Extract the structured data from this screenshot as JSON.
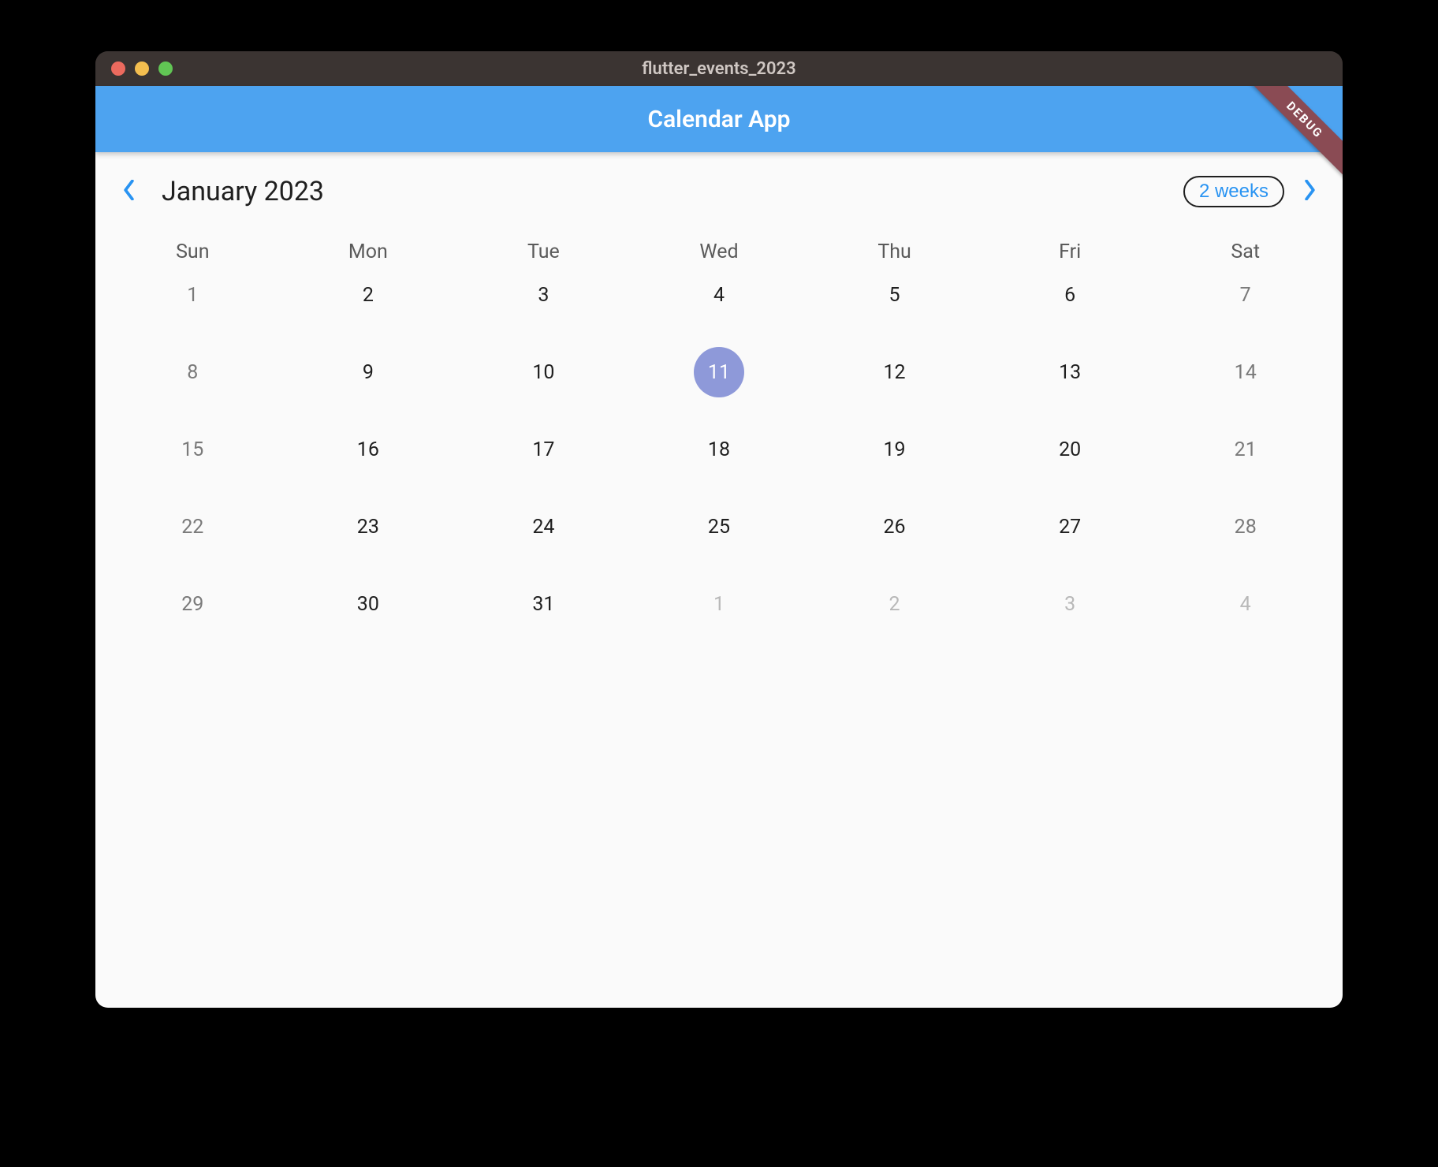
{
  "window": {
    "title": "flutter_events_2023"
  },
  "appbar": {
    "title": "Calendar App"
  },
  "debug_banner": "DEBUG",
  "calendar": {
    "month_label": "January 2023",
    "format_button": "2 weeks",
    "days_of_week": [
      "Sun",
      "Mon",
      "Tue",
      "Wed",
      "Thu",
      "Fri",
      "Sat"
    ],
    "weeks": [
      [
        {
          "n": "1",
          "weekend": true,
          "outside": false,
          "today": false
        },
        {
          "n": "2",
          "weekend": false,
          "outside": false,
          "today": false
        },
        {
          "n": "3",
          "weekend": false,
          "outside": false,
          "today": false
        },
        {
          "n": "4",
          "weekend": false,
          "outside": false,
          "today": false
        },
        {
          "n": "5",
          "weekend": false,
          "outside": false,
          "today": false
        },
        {
          "n": "6",
          "weekend": false,
          "outside": false,
          "today": false
        },
        {
          "n": "7",
          "weekend": true,
          "outside": false,
          "today": false
        }
      ],
      [
        {
          "n": "8",
          "weekend": true,
          "outside": false,
          "today": false
        },
        {
          "n": "9",
          "weekend": false,
          "outside": false,
          "today": false
        },
        {
          "n": "10",
          "weekend": false,
          "outside": false,
          "today": false
        },
        {
          "n": "11",
          "weekend": false,
          "outside": false,
          "today": true
        },
        {
          "n": "12",
          "weekend": false,
          "outside": false,
          "today": false
        },
        {
          "n": "13",
          "weekend": false,
          "outside": false,
          "today": false
        },
        {
          "n": "14",
          "weekend": true,
          "outside": false,
          "today": false
        }
      ],
      [
        {
          "n": "15",
          "weekend": true,
          "outside": false,
          "today": false
        },
        {
          "n": "16",
          "weekend": false,
          "outside": false,
          "today": false
        },
        {
          "n": "17",
          "weekend": false,
          "outside": false,
          "today": false
        },
        {
          "n": "18",
          "weekend": false,
          "outside": false,
          "today": false
        },
        {
          "n": "19",
          "weekend": false,
          "outside": false,
          "today": false
        },
        {
          "n": "20",
          "weekend": false,
          "outside": false,
          "today": false
        },
        {
          "n": "21",
          "weekend": true,
          "outside": false,
          "today": false
        }
      ],
      [
        {
          "n": "22",
          "weekend": true,
          "outside": false,
          "today": false
        },
        {
          "n": "23",
          "weekend": false,
          "outside": false,
          "today": false
        },
        {
          "n": "24",
          "weekend": false,
          "outside": false,
          "today": false
        },
        {
          "n": "25",
          "weekend": false,
          "outside": false,
          "today": false
        },
        {
          "n": "26",
          "weekend": false,
          "outside": false,
          "today": false
        },
        {
          "n": "27",
          "weekend": false,
          "outside": false,
          "today": false
        },
        {
          "n": "28",
          "weekend": true,
          "outside": false,
          "today": false
        }
      ],
      [
        {
          "n": "29",
          "weekend": true,
          "outside": false,
          "today": false
        },
        {
          "n": "30",
          "weekend": false,
          "outside": false,
          "today": false
        },
        {
          "n": "31",
          "weekend": false,
          "outside": false,
          "today": false
        },
        {
          "n": "1",
          "weekend": false,
          "outside": true,
          "today": false
        },
        {
          "n": "2",
          "weekend": false,
          "outside": true,
          "today": false
        },
        {
          "n": "3",
          "weekend": false,
          "outside": true,
          "today": false
        },
        {
          "n": "4",
          "weekend": true,
          "outside": true,
          "today": false
        }
      ]
    ]
  }
}
